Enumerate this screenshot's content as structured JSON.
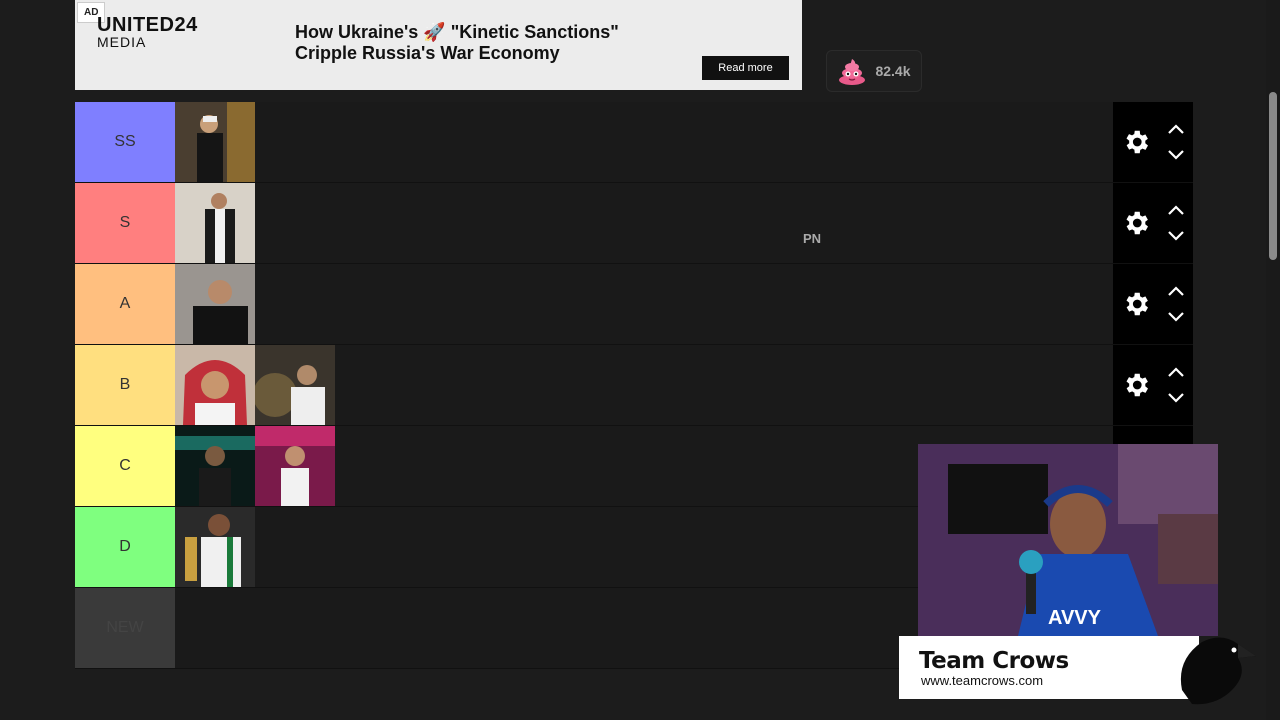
{
  "ad": {
    "tag": "AD",
    "brand_line1": "UNITED24",
    "brand_line2": "MEDIA",
    "headline": "How Ukraine's 🚀 \"Kinetic Sanctions\" Cripple Russia's War Economy",
    "cta": "Read more"
  },
  "reaction": {
    "icon": "poop-emoji-icon",
    "count": "82.4k"
  },
  "tiers": [
    {
      "label": "SS",
      "color": "#7f7fff",
      "items": 1
    },
    {
      "label": "S",
      "color": "#ff7f7f",
      "items": 1
    },
    {
      "label": "A",
      "color": "#ffbf7f",
      "items": 1
    },
    {
      "label": "B",
      "color": "#ffdf7f",
      "items": 2
    },
    {
      "label": "C",
      "color": "#ffff7f",
      "items": 2
    },
    {
      "label": "D",
      "color": "#7fff7f",
      "items": 1
    },
    {
      "label": "NEW",
      "color": "#3a3a3a",
      "items": 0
    }
  ],
  "overlay_text": "PN",
  "stream": {
    "team_name": "Team Crows",
    "url": "www.teamcrows.com"
  }
}
